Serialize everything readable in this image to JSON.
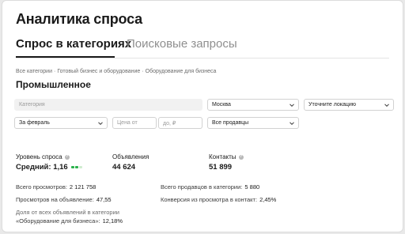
{
  "header": {
    "title": "Аналитика спроса"
  },
  "tabs": [
    {
      "label": "Спрос в категориях",
      "active": true
    },
    {
      "label": "Поисковые запросы",
      "active": false
    }
  ],
  "breadcrumb": [
    "Все категории",
    "Готовый бизнес и оборудование",
    "Оборудование для бизнеса"
  ],
  "breadcrumb_separator": "·",
  "category_title": "Промышленное",
  "filters": {
    "category_placeholder": "Категория",
    "city_value": "Москва",
    "location_placeholder": "Уточните локацию",
    "period_value": "За февраль",
    "price_from_placeholder": "Цена от",
    "price_to_placeholder": "до, ₽",
    "sellers_value": "Все продавцы"
  },
  "stats": {
    "demand_label": "Уровень спроса",
    "demand_value": "Средний: 1,16",
    "demand_level": {
      "filled": 2,
      "total": 3
    },
    "listings_label": "Объявления",
    "listings_value": "44 624",
    "contacts_label": "Контакты",
    "contacts_value": "51 899"
  },
  "metrics": {
    "views_label": "Всего просмотров:",
    "views_value": "2 121 758",
    "sellers_label": "Всего продавцов в категории:",
    "sellers_value": "5 880",
    "views_per_listing_label": "Просмотров на объявление:",
    "views_per_listing_value": "47,55",
    "conversion_label": "Конверсия из просмотра в контакт:",
    "conversion_value": "2,45%",
    "share_label_line1": "Доля от всех объявлений в категории",
    "share_label_line2": "«Оборудование для бизнеса»:",
    "share_value": "12,18%"
  },
  "colors": {
    "level_filled": "#2bb24c",
    "level_empty": "#cfeccf"
  }
}
